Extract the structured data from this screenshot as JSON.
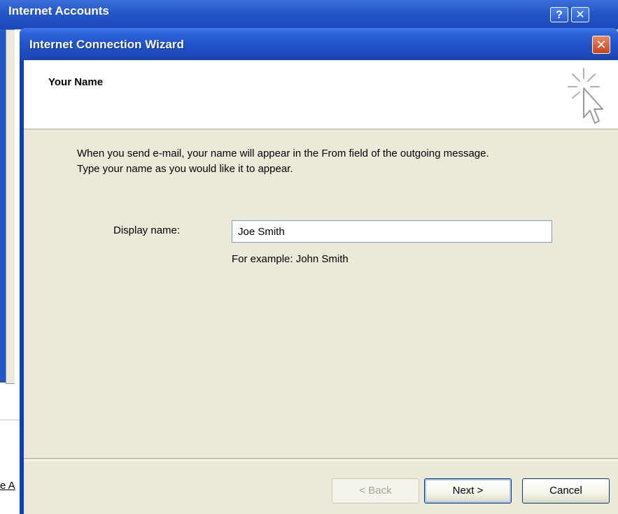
{
  "background_window": {
    "title": "Internet Accounts",
    "help_button": "?",
    "close_button": "✕",
    "link_fragment": "e A"
  },
  "wizard": {
    "title": "Internet Connection Wizard",
    "close_button": "✕",
    "heading": "Your Name",
    "header_icon": "wizard-cursor-sparkle-icon",
    "intro_line1": "When you send e-mail, your name will appear in the From field of the outgoing message.",
    "intro_line2": "Type your name as you would like it to appear.",
    "display_name_label": "Display name:",
    "display_name_value": "Joe Smith",
    "example_text": "For example: John Smith",
    "buttons": {
      "back": "< Back",
      "next": "Next >",
      "cancel": "Cancel"
    }
  },
  "colors": {
    "titlebar_blue": "#2556c8",
    "dialog_face": "#ece9d8",
    "close_red": "#c8431b"
  }
}
